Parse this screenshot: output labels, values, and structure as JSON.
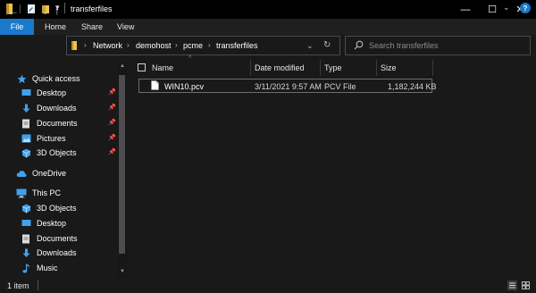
{
  "window": {
    "title": "transferfiles",
    "minimize_glyph": "—",
    "maximize_glyph": "☐",
    "close_glyph": "✕"
  },
  "quick_access_toolbar": {
    "dropdown_glyph": "▾"
  },
  "ribbon": {
    "tabs": [
      "File",
      "Home",
      "Share",
      "View"
    ],
    "expand_glyph": "⌄",
    "help_glyph": "?",
    "file_tab_color": "#1979ca"
  },
  "navigation": {
    "back_glyph": "←",
    "forward_glyph": "→",
    "recent_glyph": "⌄",
    "up_glyph": "↑",
    "breadcrumb": [
      "Network",
      "demohost",
      "pcme",
      "transferfiles"
    ],
    "breadcrumb_separator": "›",
    "address_dropdown_glyph": "⌄",
    "refresh_glyph": "↻",
    "search_placeholder": "Search transferfiles"
  },
  "nav_pane": {
    "quick_access": {
      "label": "Quick access",
      "items": [
        {
          "label": "Desktop",
          "icon": "desktop-icon",
          "pinned": true
        },
        {
          "label": "Downloads",
          "icon": "downloads-icon",
          "pinned": true
        },
        {
          "label": "Documents",
          "icon": "documents-icon",
          "pinned": true
        },
        {
          "label": "Pictures",
          "icon": "pictures-icon",
          "pinned": true
        },
        {
          "label": "3D Objects",
          "icon": "3d-objects-icon",
          "pinned": true
        }
      ]
    },
    "onedrive": {
      "label": "OneDrive"
    },
    "this_pc": {
      "label": "This PC",
      "items": [
        {
          "label": "3D Objects",
          "icon": "3d-objects-icon"
        },
        {
          "label": "Desktop",
          "icon": "desktop-icon"
        },
        {
          "label": "Documents",
          "icon": "documents-icon"
        },
        {
          "label": "Downloads",
          "icon": "downloads-icon"
        },
        {
          "label": "Music",
          "icon": "music-icon"
        }
      ]
    },
    "pin_glyph": "📌"
  },
  "file_list": {
    "columns": [
      "Name",
      "Date modified",
      "Type",
      "Size"
    ],
    "sort_glyph": "^",
    "rows": [
      {
        "name": "WIN10.pcv",
        "date_modified": "3/11/2021 9:57 AM",
        "type": "PCV File",
        "size": "1,182,244 KB"
      }
    ]
  },
  "status_bar": {
    "item_count": "1 item"
  },
  "colors": {
    "accent": "#1979ca",
    "background": "#191919",
    "title_bar": "#000000"
  }
}
